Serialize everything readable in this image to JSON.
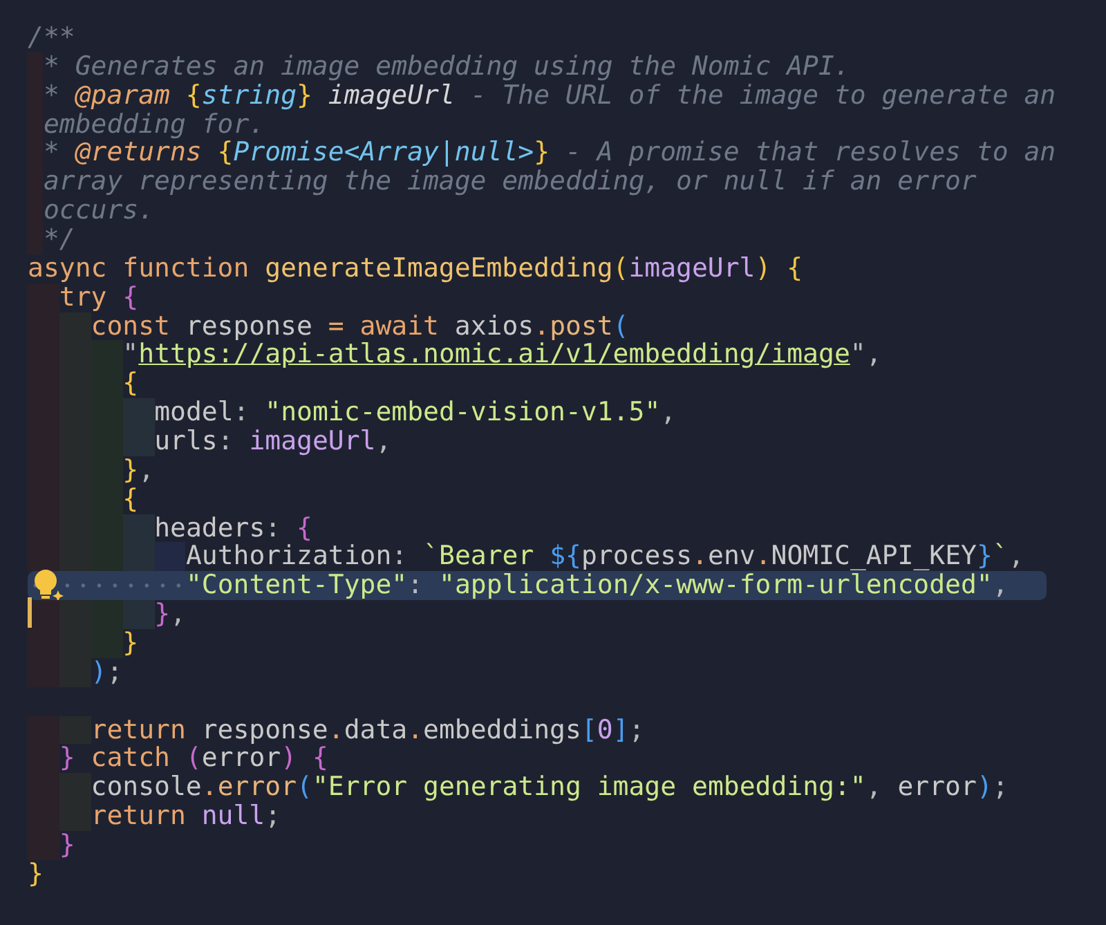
{
  "editor": {
    "lines": [
      {
        "kind": "code",
        "selected": false,
        "cursor": false,
        "tokens": [
          {
            "kind": "comment",
            "text": "/**"
          }
        ]
      },
      {
        "kind": "code",
        "selected": false,
        "cursor": false,
        "tokens": [
          {
            "kind": "comment",
            "text": " * Generates an image embedding using the Nomic API."
          }
        ]
      },
      {
        "kind": "code",
        "selected": false,
        "cursor": false,
        "tokens": [
          {
            "kind": "comment",
            "text": " * "
          },
          {
            "kind": "doc-tag",
            "text": "@param"
          },
          {
            "kind": "bracket-a",
            "text": " {"
          },
          {
            "kind": "doc-type",
            "text": "string"
          },
          {
            "kind": "bracket-a",
            "text": "}"
          },
          {
            "kind": "doc-param",
            "text": " imageUrl"
          },
          {
            "kind": "comment",
            "text": " - The URL of the image to generate an"
          }
        ]
      },
      {
        "kind": "code",
        "selected": false,
        "cursor": false,
        "tokens": [
          {
            "kind": "comment",
            "text": " embedding for."
          }
        ]
      },
      {
        "kind": "code",
        "selected": false,
        "cursor": false,
        "tokens": [
          {
            "kind": "comment",
            "text": " * "
          },
          {
            "kind": "doc-tag",
            "text": "@returns"
          },
          {
            "kind": "bracket-a",
            "text": " {"
          },
          {
            "kind": "doc-type",
            "text": "Promise<Array|null>"
          },
          {
            "kind": "bracket-a",
            "text": "}"
          },
          {
            "kind": "comment",
            "text": " - A promise that resolves to an"
          }
        ]
      },
      {
        "kind": "code",
        "selected": false,
        "cursor": false,
        "tokens": [
          {
            "kind": "comment",
            "text": " array representing the image embedding, or null if an error"
          }
        ]
      },
      {
        "kind": "code",
        "selected": false,
        "cursor": false,
        "tokens": [
          {
            "kind": "comment",
            "text": " occurs."
          }
        ]
      },
      {
        "kind": "code",
        "selected": false,
        "cursor": false,
        "tokens": [
          {
            "kind": "comment",
            "text": " */"
          }
        ]
      },
      {
        "kind": "code",
        "selected": false,
        "cursor": false,
        "tokens": [
          {
            "kind": "keyword",
            "text": "async function"
          },
          {
            "kind": "function",
            "text": " generateImageEmbedding"
          },
          {
            "kind": "bracket-a",
            "text": "("
          },
          {
            "kind": "variable",
            "text": "imageUrl"
          },
          {
            "kind": "bracket-a",
            "text": ")"
          },
          {
            "kind": "bracket-a",
            "text": " {"
          }
        ]
      },
      {
        "kind": "code",
        "selected": false,
        "cursor": false,
        "tokens": [
          {
            "kind": "keyword",
            "text": "  try"
          },
          {
            "kind": "bracket-b",
            "text": " {"
          }
        ]
      },
      {
        "kind": "code",
        "selected": false,
        "cursor": false,
        "tokens": [
          {
            "kind": "keyword",
            "text": "    const"
          },
          {
            "kind": "plain",
            "text": " response "
          },
          {
            "kind": "operator",
            "text": "="
          },
          {
            "kind": "keyword",
            "text": " await"
          },
          {
            "kind": "plain",
            "text": " axios"
          },
          {
            "kind": "operator",
            "text": "."
          },
          {
            "kind": "method",
            "text": "post"
          },
          {
            "kind": "bracket-c",
            "text": "("
          }
        ]
      },
      {
        "kind": "code",
        "selected": false,
        "cursor": false,
        "tokens": [
          {
            "kind": "punct",
            "text": "      \""
          },
          {
            "kind": "url",
            "text": "https://api-atlas.nomic.ai/v1/embedding/image"
          },
          {
            "kind": "punct",
            "text": "\","
          }
        ]
      },
      {
        "kind": "code",
        "selected": false,
        "cursor": false,
        "tokens": [
          {
            "kind": "bracket-a",
            "text": "      {"
          }
        ]
      },
      {
        "kind": "code",
        "selected": false,
        "cursor": false,
        "tokens": [
          {
            "kind": "plain",
            "text": "        model"
          },
          {
            "kind": "punct",
            "text": ":"
          },
          {
            "kind": "string",
            "text": " \"nomic-embed-vision-v1.5\""
          },
          {
            "kind": "punct",
            "text": ","
          }
        ]
      },
      {
        "kind": "code",
        "selected": false,
        "cursor": false,
        "tokens": [
          {
            "kind": "plain",
            "text": "        urls"
          },
          {
            "kind": "punct",
            "text": ":"
          },
          {
            "kind": "variable",
            "text": " imageUrl"
          },
          {
            "kind": "punct",
            "text": ","
          }
        ]
      },
      {
        "kind": "code",
        "selected": false,
        "cursor": false,
        "tokens": [
          {
            "kind": "bracket-a",
            "text": "      }"
          },
          {
            "kind": "punct",
            "text": ","
          }
        ]
      },
      {
        "kind": "code",
        "selected": false,
        "cursor": false,
        "tokens": [
          {
            "kind": "bracket-a",
            "text": "      {"
          }
        ]
      },
      {
        "kind": "code",
        "selected": false,
        "cursor": false,
        "tokens": [
          {
            "kind": "plain",
            "text": "        headers"
          },
          {
            "kind": "punct",
            "text": ":"
          },
          {
            "kind": "bracket-b",
            "text": " {"
          }
        ]
      },
      {
        "kind": "code",
        "selected": false,
        "cursor": false,
        "tokens": [
          {
            "kind": "plain",
            "text": "          Authorization"
          },
          {
            "kind": "punct",
            "text": ":"
          },
          {
            "kind": "string",
            "text": " `Bearer"
          },
          {
            "kind": "bracket-c",
            "text": " ${"
          },
          {
            "kind": "plain",
            "text": "process"
          },
          {
            "kind": "operator",
            "text": "."
          },
          {
            "kind": "plain",
            "text": "env"
          },
          {
            "kind": "operator",
            "text": "."
          },
          {
            "kind": "plain",
            "text": "NOMIC_API_KEY"
          },
          {
            "kind": "bracket-c",
            "text": "}"
          },
          {
            "kind": "string",
            "text": "`"
          },
          {
            "kind": "punct",
            "text": ","
          }
        ]
      },
      {
        "kind": "code",
        "selected": true,
        "cursor": false,
        "tokens": [
          {
            "kind": "string",
            "text": "          \"Content-Type\""
          },
          {
            "kind": "punct",
            "text": ":"
          },
          {
            "kind": "string",
            "text": " \"application/x-www-form-urlencoded\""
          },
          {
            "kind": "punct",
            "text": ","
          }
        ]
      },
      {
        "kind": "code",
        "selected": false,
        "cursor": true,
        "tokens": [
          {
            "kind": "bracket-b",
            "text": "        }"
          },
          {
            "kind": "punct",
            "text": ","
          }
        ]
      },
      {
        "kind": "code",
        "selected": false,
        "cursor": false,
        "tokens": [
          {
            "kind": "bracket-a",
            "text": "      }"
          }
        ]
      },
      {
        "kind": "code",
        "selected": false,
        "cursor": false,
        "tokens": [
          {
            "kind": "bracket-c",
            "text": "    )"
          },
          {
            "kind": "punct",
            "text": ";"
          }
        ]
      },
      {
        "kind": "blank"
      },
      {
        "kind": "code",
        "selected": false,
        "cursor": false,
        "tokens": [
          {
            "kind": "keyword",
            "text": "    return"
          },
          {
            "kind": "plain",
            "text": " response"
          },
          {
            "kind": "operator",
            "text": "."
          },
          {
            "kind": "plain",
            "text": "data"
          },
          {
            "kind": "operator",
            "text": "."
          },
          {
            "kind": "plain",
            "text": "embeddings"
          },
          {
            "kind": "bracket-c",
            "text": "["
          },
          {
            "kind": "number",
            "text": "0"
          },
          {
            "kind": "bracket-c",
            "text": "]"
          },
          {
            "kind": "punct",
            "text": ";"
          }
        ]
      },
      {
        "kind": "code",
        "selected": false,
        "cursor": false,
        "tokens": [
          {
            "kind": "bracket-b",
            "text": "  }"
          },
          {
            "kind": "keyword",
            "text": " catch"
          },
          {
            "kind": "bracket-b",
            "text": " ("
          },
          {
            "kind": "plain",
            "text": "error"
          },
          {
            "kind": "bracket-b",
            "text": ")"
          },
          {
            "kind": "bracket-b",
            "text": " {"
          }
        ]
      },
      {
        "kind": "code",
        "selected": false,
        "cursor": false,
        "tokens": [
          {
            "kind": "plain",
            "text": "    console"
          },
          {
            "kind": "operator",
            "text": "."
          },
          {
            "kind": "method",
            "text": "error"
          },
          {
            "kind": "bracket-c",
            "text": "("
          },
          {
            "kind": "string",
            "text": "\"Error generating image embedding:\""
          },
          {
            "kind": "punct",
            "text": ","
          },
          {
            "kind": "plain",
            "text": " error"
          },
          {
            "kind": "bracket-c",
            "text": ")"
          },
          {
            "kind": "punct",
            "text": ";"
          }
        ]
      },
      {
        "kind": "code",
        "selected": false,
        "cursor": false,
        "tokens": [
          {
            "kind": "keyword",
            "text": "    return"
          },
          {
            "kind": "variable",
            "text": " null"
          },
          {
            "kind": "punct",
            "text": ";"
          }
        ]
      },
      {
        "kind": "code",
        "selected": false,
        "cursor": false,
        "tokens": [
          {
            "kind": "bracket-b",
            "text": "  }"
          }
        ]
      },
      {
        "kind": "code",
        "selected": false,
        "cursor": false,
        "tokens": [
          {
            "kind": "bracket-a",
            "text": "}"
          }
        ]
      }
    ]
  }
}
